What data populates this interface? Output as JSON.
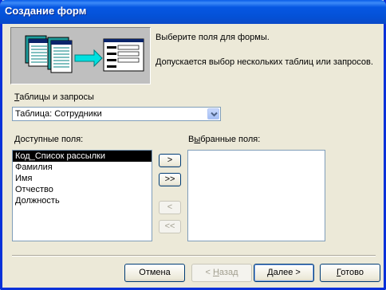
{
  "window": {
    "title": "Создание форм"
  },
  "header": {
    "line1": "Выберите поля для формы.",
    "line2": "Допускается выбор нескольких таблиц или запросов."
  },
  "source": {
    "label": "Таблицы и запросы",
    "label_rest": "аблицы и запросы",
    "label_mnemonic": "Т",
    "value": "Таблица: Сотрудники"
  },
  "available": {
    "label": "Доступные поля:",
    "label_mnemonic": "Д",
    "label_rest": "оступные поля:",
    "items": [
      "Код_Список рассылки",
      "Фамилия",
      "Имя",
      "Отчество",
      "Должность"
    ],
    "selected_index": 0
  },
  "chosen": {
    "label": "Выбранные поля:",
    "label_mnemonic": "ы",
    "label_pre": "В",
    "label_post": "бранные поля:",
    "items": []
  },
  "transfer": {
    "add_one": ">",
    "add_all": ">>",
    "remove_one": "<",
    "remove_all": "<<"
  },
  "footer": {
    "cancel": "Отмена",
    "back": "< Назад",
    "back_pre": "< ",
    "back_mnemonic": "Н",
    "back_rest": "азад",
    "next": "Далее >",
    "next_mnemonic": "Д",
    "next_rest": "алее >",
    "finish": "Готово",
    "finish_mnemonic": "Г",
    "finish_rest": "отово"
  }
}
